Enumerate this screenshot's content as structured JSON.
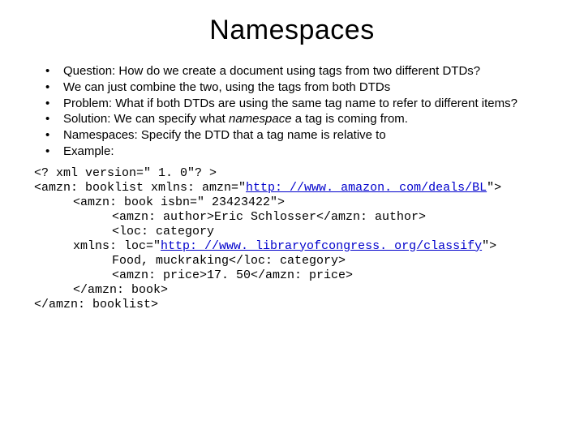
{
  "title": "Namespaces",
  "bullets": [
    {
      "text": "Question: How do we create a document using tags from two different DTDs?"
    },
    {
      "text": "We can just combine the two, using the tags from both DTDs"
    },
    {
      "text": "Problem: What if both DTDs are using the same tag name to refer to different items?"
    },
    {
      "prefix": "Solution: We can specify what ",
      "em": "namespace",
      "suffix": " a tag is coming from."
    },
    {
      "text": "Namespaces: Specify the DTD that a tag name is relative to"
    },
    {
      "text": "Example:"
    }
  ],
  "code": {
    "l1": "<? xml version=\" 1. 0\"? >",
    "l2a": "<amzn: booklist xmlns: amzn=\"",
    "l2link": "http: //www. amazon. com/deals/BL",
    "l2b": "\">",
    "l3": "<amzn: book isbn=\" 23423422\">",
    "l4": "<amzn: author>Eric Schlosser</amzn: author>",
    "l5": "<loc: category",
    "l6a": "xmlns: loc=\"",
    "l6link": "http: //www. libraryofcongress. org/classify",
    "l6b": "\">",
    "l7": "Food, muckraking</loc: category>",
    "l8": "<amzn: price>17. 50</amzn: price>",
    "l9": "</amzn: book>",
    "l10": "</amzn: booklist>"
  }
}
